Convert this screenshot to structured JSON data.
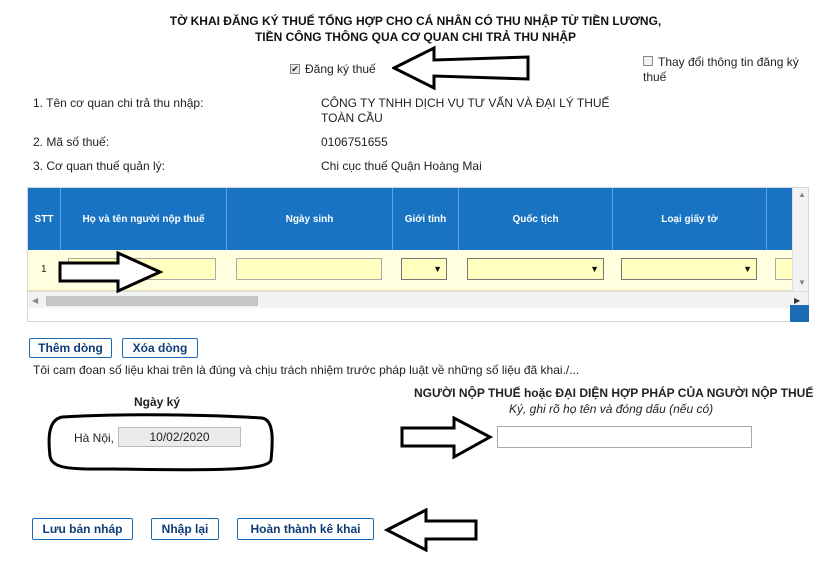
{
  "form": {
    "title_line1": "TỜ KHAI ĐĂNG KÝ THUẾ TỔNG HỢP CHO CÁ NHÂN CÓ THU NHẬP TỪ TIỀN LƯƠNG,",
    "title_line2": "TIỀN CÔNG THÔNG QUA CƠ QUAN CHI TRẢ THU NHẬP",
    "register_label": "Đăng ký thuế",
    "change_info_label_1": "Thay đổi thông tin đăng ký",
    "change_info_label_2": "thuế"
  },
  "info": {
    "org_name_label": "1. Tên cơ quan chi trả thu nhập:",
    "org_name_line1": "CÔNG TY TNHH DỊCH VỤ TƯ VẤN VÀ ĐẠI LÝ THUẾ",
    "org_name_line2": "TOÀN CẦU",
    "tax_code_label": "2. Mã số thuế:",
    "tax_code": "0106751655",
    "tax_office_label": "3. Cơ quan thuế quản lý:",
    "tax_office": "Chi cục thuế Quận Hoàng Mai"
  },
  "table": {
    "headers": [
      "STT",
      "Họ và tên người nộp thuế",
      "Ngày sinh",
      "Giới tính",
      "Quốc tịch",
      "Loại giấy tờ"
    ],
    "rows": [
      {
        "stt": "1"
      }
    ]
  },
  "table_buttons": {
    "add_row": "Thêm dòng",
    "delete_row": "Xóa dòng"
  },
  "declaration": "Tôi cam đoan số liệu khai trên là đúng và chịu trách nhiệm trước pháp luật về những số liệu đã khai./...",
  "sign": {
    "date_heading": "Ngày ký",
    "place": "Hà Nội,",
    "date_value": "10/02/2020",
    "signer_heading": "NGƯỜI NỘP THUẾ hoặc ĐẠI DIỆN HỢP PHÁP CỦA NGƯỜI NỘP THUẾ",
    "signer_note": "Ký, ghi rõ họ tên và đóng dấu (nếu có)",
    "signer_value": ""
  },
  "actions": {
    "save_draft": "Lưu bản nháp",
    "reset": "Nhập lại",
    "finish": "Hoàn thành kê khai"
  },
  "colors": {
    "header_blue": "#1873c2",
    "row_yellow": "#ffffe0",
    "button_border": "#1c6bb5"
  }
}
